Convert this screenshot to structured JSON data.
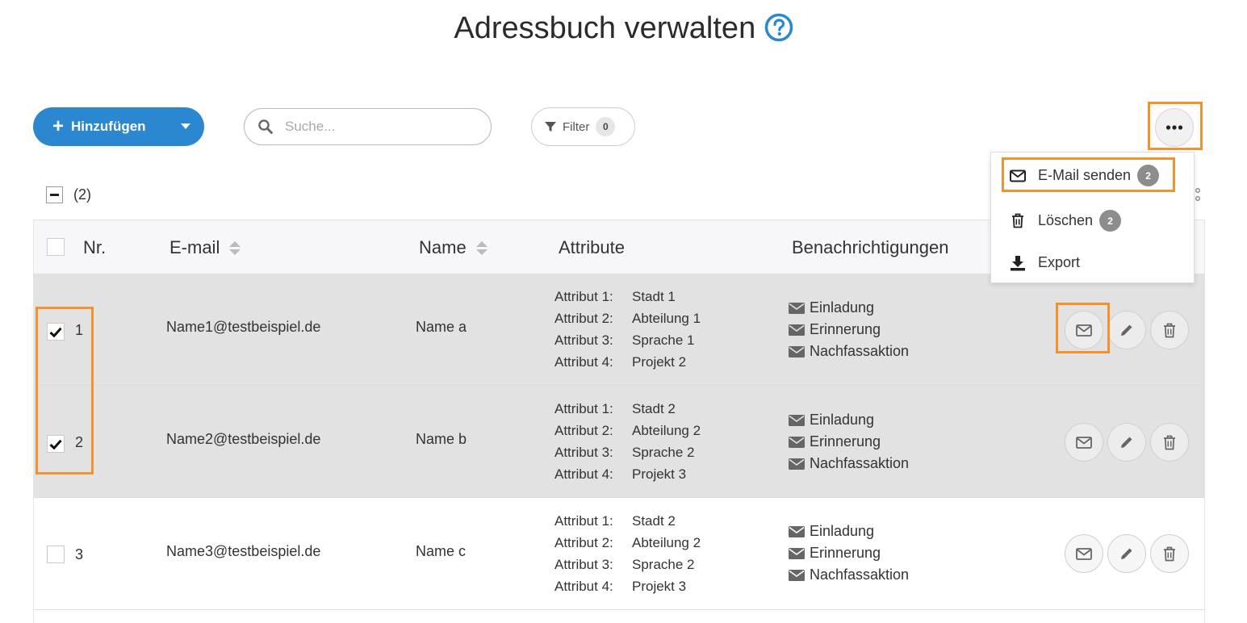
{
  "page": {
    "title": "Adressbuch verwalten"
  },
  "toolbar": {
    "add_label": "Hinzufügen",
    "search_placeholder": "Suche...",
    "filter_label": "Filter",
    "filter_count": "0"
  },
  "dropdown": {
    "items": [
      {
        "label": "E-Mail senden",
        "badge": "2",
        "icon": "envelope-icon"
      },
      {
        "label": "Löschen",
        "badge": "2",
        "icon": "trash-icon"
      },
      {
        "label": "Export",
        "icon": "download-icon"
      }
    ]
  },
  "selection": {
    "count_label": "(2)"
  },
  "table": {
    "headers": {
      "nr": "Nr.",
      "email": "E-mail",
      "name": "Name",
      "attribute": "Attribute",
      "notifications": "Benachrichtigungen"
    },
    "rows": [
      {
        "nr": "1",
        "email": "Name1@testbeispiel.de",
        "name": "Name a",
        "selected": true,
        "attributes": [
          {
            "key": "Attribut 1:",
            "value": "Stadt 1"
          },
          {
            "key": "Attribut 2:",
            "value": "Abteilung 1"
          },
          {
            "key": "Attribut 3:",
            "value": "Sprache 1"
          },
          {
            "key": "Attribut 4:",
            "value": "Projekt 2"
          }
        ],
        "notifications": [
          "Einladung",
          "Erinnerung",
          "Nachfassaktion"
        ]
      },
      {
        "nr": "2",
        "email": "Name2@testbeispiel.de",
        "name": "Name b",
        "selected": true,
        "attributes": [
          {
            "key": "Attribut 1:",
            "value": "Stadt 2"
          },
          {
            "key": "Attribut 2:",
            "value": "Abteilung 2"
          },
          {
            "key": "Attribut 3:",
            "value": "Sprache 2"
          },
          {
            "key": "Attribut 4:",
            "value": "Projekt 3"
          }
        ],
        "notifications": [
          "Einladung",
          "Erinnerung",
          "Nachfassaktion"
        ]
      },
      {
        "nr": "3",
        "email": "Name3@testbeispiel.de",
        "name": "Name c",
        "selected": false,
        "attributes": [
          {
            "key": "Attribut 1:",
            "value": "Stadt 2"
          },
          {
            "key": "Attribut 2:",
            "value": "Abteilung 2"
          },
          {
            "key": "Attribut 3:",
            "value": "Sprache 2"
          },
          {
            "key": "Attribut 4:",
            "value": "Projekt 3"
          }
        ],
        "notifications": [
          "Einladung",
          "Erinnerung",
          "Nachfassaktion"
        ]
      }
    ]
  },
  "colors": {
    "primary": "#2a87d0",
    "highlight": "#f2922e",
    "selected_row": "#e2e2e2",
    "badge": "#8d8d8d"
  }
}
